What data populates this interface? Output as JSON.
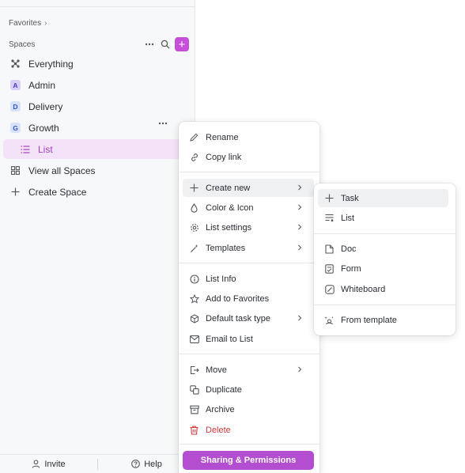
{
  "sidebar": {
    "favorites_label": "Favorites",
    "spaces_label": "Spaces",
    "items": [
      {
        "label": "Everything"
      },
      {
        "label": "Admin",
        "avatar": "A"
      },
      {
        "label": "Delivery",
        "avatar": "D"
      },
      {
        "label": "Growth",
        "avatar": "G"
      },
      {
        "label": "List"
      },
      {
        "label": "View all Spaces"
      },
      {
        "label": "Create Space"
      }
    ],
    "invite_label": "Invite",
    "help_label": "Help",
    "accent_color": "#c64fd9"
  },
  "context_menu": {
    "rename": "Rename",
    "copy_link": "Copy link",
    "create_new": "Create new",
    "color_icon": "Color & Icon",
    "list_settings": "List settings",
    "templates": "Templates",
    "list_info": "List Info",
    "add_favorites": "Add to Favorites",
    "default_task_type": "Default task type",
    "email_to_list": "Email to List",
    "move": "Move",
    "duplicate": "Duplicate",
    "archive": "Archive",
    "delete": "Delete",
    "sharing_permissions": "Sharing & Permissions",
    "danger_color": "#cf3b3b"
  },
  "submenu": {
    "task": "Task",
    "list": "List",
    "doc": "Doc",
    "form": "Form",
    "whiteboard": "Whiteboard",
    "from_template": "From template"
  }
}
